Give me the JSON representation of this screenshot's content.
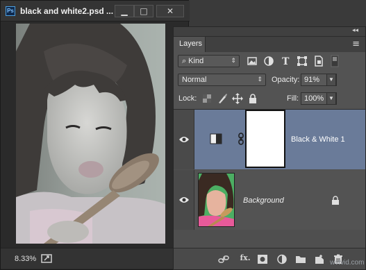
{
  "document_window": {
    "app_icon_text": "Ps",
    "title": "black and white2.psd ...",
    "minimize_symbol": "▁",
    "maximize_symbol": "□",
    "close_symbol": "✕",
    "zoom": "8.33%"
  },
  "layers_panel": {
    "collapse_symbol": "◂◂",
    "tab_label": "Layers",
    "menu_symbol": "≡",
    "filter": {
      "kind_label": "Kind",
      "search_symbol": "⌕"
    },
    "blend_mode": "Normal",
    "opacity_label": "Opacity:",
    "opacity_value": "91%",
    "lock_label": "Lock:",
    "fill_label": "Fill:",
    "fill_value": "100%",
    "layers": [
      {
        "name": "Black & White 1",
        "selected": true,
        "visible": true,
        "type": "adjustment"
      },
      {
        "name": "Background",
        "selected": false,
        "visible": true,
        "locked": true,
        "type": "pixel"
      }
    ],
    "footer_icons": [
      "link-icon",
      "fx-icon",
      "add-mask-icon",
      "adjustment-layer-icon",
      "group-folder-icon",
      "new-layer-icon",
      "trash-icon"
    ],
    "fx_text": "fx."
  },
  "watermark": "wvtvid.com",
  "colors": {
    "selected_layer": "#6a7b99",
    "panel_bg": "#535353",
    "ps_accent": "#4b9fe0"
  }
}
